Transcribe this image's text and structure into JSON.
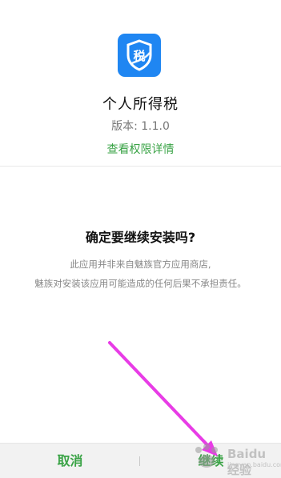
{
  "app": {
    "name": "个人所得税",
    "version": "版本: 1.1.0",
    "permission_link": "查看权限详情",
    "icon_glyph": "税",
    "icon_color": "#1f86f2"
  },
  "dialog": {
    "question": "确定要继续安装吗?",
    "note_line1": "此应用并非来自魅族官方应用商店,",
    "note_line2": "魅族对安装该应用可能造成的任何后果不承担责任。"
  },
  "actions": {
    "cancel_label": "取消",
    "continue_label": "继续",
    "accent_color": "#3aa346"
  },
  "overlay": {
    "arrow_color": "#e83ce6",
    "watermark_text": "Baidu 经验",
    "watermark_sub": "jingyan.baidu.com"
  }
}
